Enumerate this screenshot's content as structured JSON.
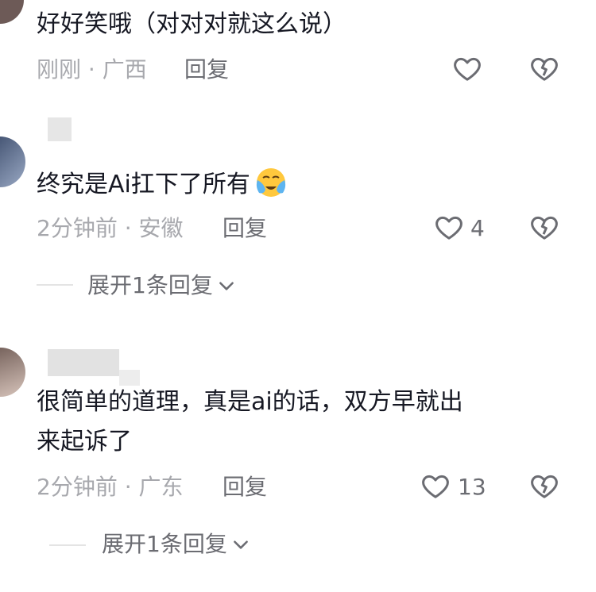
{
  "comments": [
    {
      "text": "好好笑哦（对对对就这么说）",
      "time": "刚刚",
      "sep": "·",
      "location": "广西",
      "reply_label": "回复",
      "likes": ""
    },
    {
      "text": "终究是Ai扛下了所有",
      "emoji": "crying-face",
      "time": "2分钟前",
      "sep": "·",
      "location": "安徽",
      "reply_label": "回复",
      "likes": "4",
      "expand_label": "展开1条回复"
    },
    {
      "text_line1": "很简单的道理，真是ai的话，双方早就出",
      "text_line2": "来起诉了",
      "time": "2分钟前",
      "sep": "·",
      "location": "广东",
      "reply_label": "回复",
      "likes": "13",
      "expand_label": "展开1条回复"
    }
  ],
  "colors": {
    "text": "#161823",
    "meta": "#a7a8ad",
    "icon": "#6b6c72",
    "emoji": "#ffc83d"
  },
  "icons": [
    "heart-icon",
    "broken-heart-icon",
    "chevron-down-icon"
  ]
}
